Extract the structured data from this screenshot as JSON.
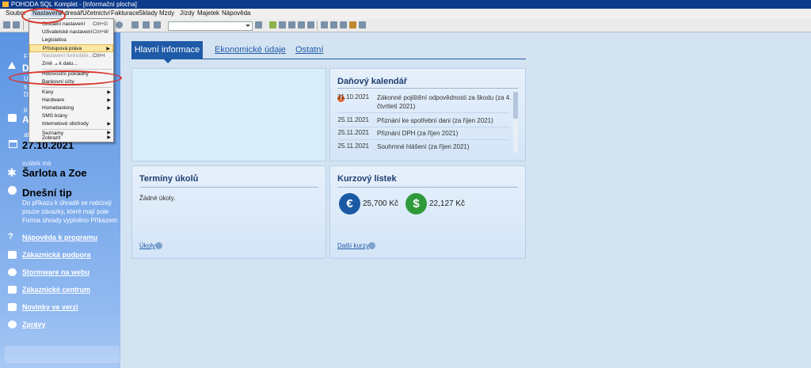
{
  "window": {
    "title": "POHODA SQL Komplet - [Informační plocha]"
  },
  "menu": {
    "items": [
      "Soubor",
      "Nastavení",
      "Adresář",
      "Účetnictví",
      "Fakturace",
      "Sklady",
      "Mzdy",
      "Jízdy",
      "Majetek",
      "Nápověda"
    ]
  },
  "dropdown": {
    "items": [
      {
        "label": "Globální nastavení",
        "shortcut": "Ctrl+G"
      },
      {
        "label": "Uživatelské nastavení",
        "shortcut": "Ctrl+W"
      },
      {
        "label": "Legislativa"
      },
      {
        "label": "Přístupová práva",
        "submenu": true,
        "highlighted": true
      },
      {
        "label": "Nastavení formuláře...",
        "shortcut": "Ctrl+I",
        "disabled": true
      },
      {
        "label": "Změnit k datu..."
      },
      {
        "label": "Hotovostní pokladny"
      },
      {
        "label": "Bankovní účty"
      },
      {
        "label": "Kasy",
        "submenu": true
      },
      {
        "label": "Hardware",
        "submenu": true
      },
      {
        "label": "Homebanking",
        "submenu": true
      },
      {
        "label": "SMS brány"
      },
      {
        "label": "Internetové obchody",
        "submenu": true
      },
      {
        "label": "Seznamy",
        "submenu": true
      },
      {
        "label": "Zobrazit",
        "submenu": true
      }
    ]
  },
  "sidebar": {
    "frag_f": "F",
    "frag_d": "D",
    "frag_u": "U",
    "frag_s": "s",
    "frag_d2": "D",
    "frag_p": "p",
    "frag_a": "A",
    "frag_at": "at",
    "date": "27.10.2021",
    "namesday_label": "svátek má",
    "namesday": "Šarlota a Zoe",
    "tip_title": "Dnešní tip",
    "tip_lines": [
      "Do příkazu k úhradě se nabízejí",
      "pouze závazky, které mají pole",
      "Forma úhrady vyplněno Příkazem"
    ],
    "links": [
      "Nápověda k programu",
      "Zákaznická podpora",
      "Stormware na webu",
      "Zákaznické centrum",
      "Novinky ve verzi",
      "Zprávy"
    ]
  },
  "tabs": {
    "active": "Hlavní informace",
    "tab2": "Ekonomické údaje",
    "tab3": "Ostatní"
  },
  "tax_calendar": {
    "title": "Daňový kalendář",
    "rows": [
      {
        "date": "31.10.2021",
        "text": "Zákonné pojištění odpovědnosti za škodu (za 4. čtvrtletí 2021)",
        "warning": true
      },
      {
        "date": "25.11.2021",
        "text": "Přiznání ke spotřební dani (za říjen 2021)"
      },
      {
        "date": "25.11.2021",
        "text": "Přiznání DPH (za říjen 2021)"
      },
      {
        "date": "25.11.2021",
        "text": "Souhrnné hlášení (za říjen 2021)"
      }
    ]
  },
  "tasks": {
    "title": "Termíny úkolů",
    "empty": "Žádné úkoly.",
    "link": "Úkoly"
  },
  "rates": {
    "title": "Kurzový lístek",
    "eur_symbol": "€",
    "eur": "25,700 Kč",
    "usd_symbol": "$",
    "usd": "22,127 Kč",
    "link": "Další kurzy"
  },
  "colors": {
    "accent": "#1f5aa8",
    "highlight_ring": "#d9342b",
    "eur_coin": "#1a5aa4",
    "usd_coin": "#2f9a3a"
  }
}
